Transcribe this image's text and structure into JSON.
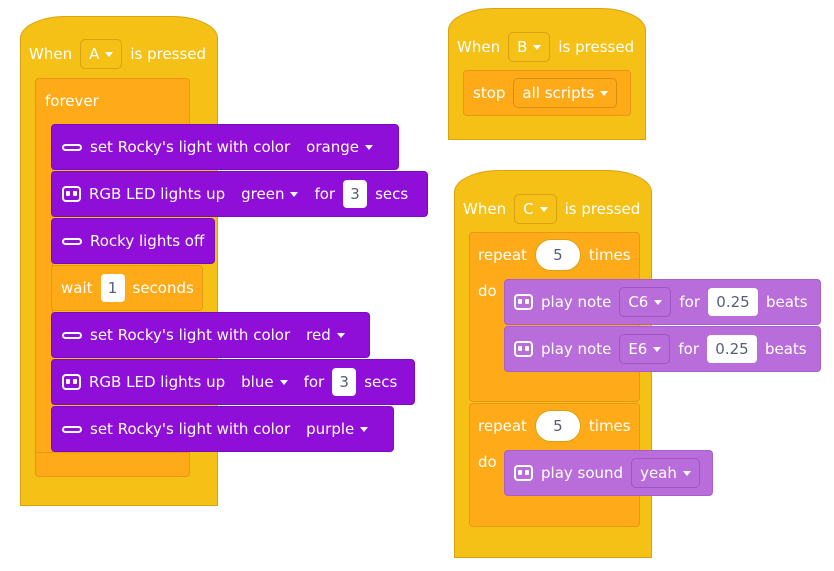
{
  "script_a": {
    "when": "When",
    "key": "A",
    "is_pressed": "is pressed",
    "forever": "forever",
    "blocks": [
      {
        "text": "set Rocky's light with color",
        "dropdown": "orange"
      },
      {
        "text": "RGB LED lights up",
        "dropdown": "green",
        "for": "for",
        "value": "3",
        "unit": "secs"
      },
      {
        "text": "Rocky lights off"
      },
      {
        "text": "wait",
        "value": "1",
        "unit": "seconds"
      },
      {
        "text": "set Rocky's light with color",
        "dropdown": "red"
      },
      {
        "text": "RGB LED lights up",
        "dropdown": "blue",
        "for": "for",
        "value": "3",
        "unit": "secs"
      },
      {
        "text": "set Rocky's light with color",
        "dropdown": "purple"
      }
    ]
  },
  "script_b": {
    "when": "When",
    "key": "B",
    "is_pressed": "is pressed",
    "stop": "stop",
    "stop_option": "all scripts"
  },
  "script_c": {
    "when": "When",
    "key": "C",
    "is_pressed": "is pressed",
    "repeat1": {
      "repeat": "repeat",
      "count": "5",
      "times": "times",
      "do": "do"
    },
    "notes": [
      {
        "text": "play note",
        "note": "C6",
        "for": "for",
        "beats_value": "0.25",
        "beats": "beats"
      },
      {
        "text": "play note",
        "note": "E6",
        "for": "for",
        "beats_value": "0.25",
        "beats": "beats"
      }
    ],
    "repeat2": {
      "repeat": "repeat",
      "count": "5",
      "times": "times",
      "do": "do"
    },
    "sound": {
      "text": "play sound",
      "option": "yeah"
    }
  },
  "icons": {
    "light_strip": "light-bar-icon",
    "robot_face": "robot-face-icon",
    "dropdown": "chevron-down-icon"
  },
  "colors": {
    "event": "#f5c116",
    "control": "#ffab19",
    "rocky": "#8f0fd8",
    "sound": "#b86ddb"
  }
}
